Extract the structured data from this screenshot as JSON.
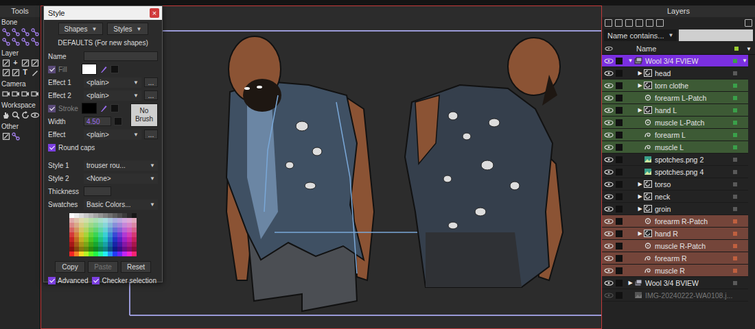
{
  "tools_panel": {
    "title": "Tools",
    "sections": [
      {
        "label": "Bone",
        "tools": [
          {
            "kind": "bone"
          },
          {
            "kind": "bone"
          },
          {
            "kind": "bone"
          },
          {
            "kind": "bone"
          },
          {
            "kind": "bone"
          },
          {
            "kind": "bone"
          },
          {
            "kind": "bone"
          },
          {
            "kind": "bone"
          }
        ]
      },
      {
        "label": "Layer",
        "tools": [
          {
            "kind": "transform"
          },
          {
            "kind": "add",
            "glyph": "+"
          },
          {
            "kind": "transform"
          },
          {
            "kind": "transform"
          },
          {
            "kind": "transform"
          },
          {
            "kind": "transform"
          },
          {
            "kind": "text",
            "glyph": "T"
          },
          {
            "kind": "pen"
          }
        ]
      },
      {
        "label": "Camera",
        "tools": [
          {
            "kind": "camera"
          },
          {
            "kind": "camera"
          },
          {
            "kind": "camera"
          },
          {
            "kind": "camera"
          }
        ]
      },
      {
        "label": "Workspace",
        "tools": [
          {
            "kind": "hand"
          },
          {
            "kind": "zoom"
          },
          {
            "kind": "rotate"
          },
          {
            "kind": "eye"
          }
        ]
      },
      {
        "label": "Other",
        "tools": [
          {
            "kind": "other"
          },
          {
            "kind": "bone"
          }
        ]
      }
    ]
  },
  "style_window": {
    "title": "Style",
    "close": "×",
    "menus": [
      {
        "label": "Shapes",
        "arrow": "▼"
      },
      {
        "label": "Styles",
        "arrow": "▼"
      }
    ],
    "heading": "DEFAULTS (For new shapes)",
    "name": {
      "label": "Name",
      "value": ""
    },
    "fill": {
      "label": "Fill",
      "checked": true,
      "disabled": true,
      "color": "#ffffff"
    },
    "effects": [
      {
        "label": "Effect 1",
        "value": "<plain>",
        "arrow": "▼",
        "more": "..."
      },
      {
        "label": "Effect 2",
        "value": "<plain>",
        "arrow": "▼",
        "more": "..."
      }
    ],
    "stroke": {
      "label": "Stroke",
      "checked": true,
      "disabled": true,
      "color": "#000000",
      "brush_button": "No Brush"
    },
    "width": {
      "label": "Width",
      "value": "4.50"
    },
    "stroke_effect": {
      "label": "Effect",
      "value": "<plain>",
      "arrow": "▼",
      "more": "..."
    },
    "round_caps": {
      "label": "Round caps",
      "checked": true
    },
    "styles": [
      {
        "label": "Style 1",
        "value": "trouser rou...",
        "arrow": "▼"
      },
      {
        "label": "Style 2",
        "value": "<None>",
        "arrow": "▼"
      }
    ],
    "thickness": {
      "label": "Thickness",
      "value": ""
    },
    "swatches": {
      "label": "Swatches",
      "value": "Basic Colors...",
      "arrow": "▼"
    },
    "buttons": [
      {
        "label": "Copy",
        "disabled": false
      },
      {
        "label": "Paste",
        "disabled": true
      },
      {
        "label": "Reset",
        "disabled": false
      }
    ],
    "options": [
      {
        "label": "Advanced",
        "checked": true
      },
      {
        "label": "Checker selection",
        "checked": true
      }
    ]
  },
  "layers_panel": {
    "title": "Layers",
    "filter": {
      "label": "Name contains...",
      "arrow": "▼",
      "value": ""
    },
    "column": "Name",
    "column_arrow": "▼",
    "rows": [
      {
        "name": "Wool 3/4 FVIEW",
        "kind": "group",
        "depth": 0,
        "arrow": "▼",
        "expanded": true,
        "selected": true,
        "visible": true,
        "color": "#7a2fe0",
        "label": "#3aa04a",
        "menu": "▼"
      },
      {
        "name": "head",
        "kind": "switch",
        "depth": 1,
        "arrow": "▶",
        "expanded": false,
        "selected": false,
        "visible": true,
        "color": null,
        "label": "#5a5a5a"
      },
      {
        "name": "torn clothe",
        "kind": "switch",
        "depth": 1,
        "arrow": "▶",
        "expanded": false,
        "selected": false,
        "visible": true,
        "color": "#3d5a35",
        "label": "#3aa04a"
      },
      {
        "name": "forearm L-Patch",
        "kind": "patch",
        "depth": 1,
        "selected": false,
        "visible": true,
        "color": "#3d5a35",
        "label": "#3aa04a"
      },
      {
        "name": "hand L",
        "kind": "switch",
        "depth": 1,
        "arrow": "▶",
        "expanded": false,
        "selected": false,
        "visible": true,
        "color": "#3d5a35",
        "label": "#3aa04a"
      },
      {
        "name": "muscle L-Patch",
        "kind": "patch",
        "depth": 1,
        "selected": false,
        "visible": true,
        "color": "#3d5a35",
        "label": "#3aa04a"
      },
      {
        "name": "forearm L",
        "kind": "vector",
        "depth": 1,
        "selected": false,
        "visible": true,
        "color": "#3d5a35",
        "label": "#3aa04a"
      },
      {
        "name": "muscle L",
        "kind": "vector",
        "depth": 1,
        "selected": false,
        "visible": true,
        "color": "#3d5a35",
        "label": "#3aa04a"
      },
      {
        "name": "spotches.png 2",
        "kind": "image",
        "depth": 1,
        "selected": false,
        "visible": true,
        "color": null,
        "label": "#5a5a5a"
      },
      {
        "name": "spotches.png 4",
        "kind": "image",
        "depth": 1,
        "selected": false,
        "visible": true,
        "color": null,
        "label": "#5a5a5a"
      },
      {
        "name": "torso",
        "kind": "switch",
        "depth": 1,
        "arrow": "▶",
        "expanded": false,
        "selected": false,
        "visible": true,
        "color": null,
        "label": "#5a5a5a"
      },
      {
        "name": "neck",
        "kind": "switch",
        "depth": 1,
        "arrow": "▶",
        "expanded": false,
        "selected": false,
        "visible": true,
        "color": null,
        "label": "#5a5a5a"
      },
      {
        "name": "groin",
        "kind": "switch",
        "depth": 1,
        "arrow": "▶",
        "expanded": false,
        "selected": false,
        "visible": true,
        "color": null,
        "label": "#5a5a5a"
      },
      {
        "name": "forearm R-Patch",
        "kind": "patch",
        "depth": 1,
        "selected": false,
        "visible": true,
        "color": "#74453a",
        "label": "#c0603f"
      },
      {
        "name": "hand R",
        "kind": "switch",
        "depth": 1,
        "arrow": "▶",
        "expanded": false,
        "selected": false,
        "visible": true,
        "color": "#74453a",
        "label": "#c0603f"
      },
      {
        "name": "muscle R-Patch",
        "kind": "patch",
        "depth": 1,
        "selected": false,
        "visible": true,
        "color": "#74453a",
        "label": "#c0603f"
      },
      {
        "name": "forearm R",
        "kind": "vector",
        "depth": 1,
        "selected": false,
        "visible": true,
        "color": "#74453a",
        "label": "#c0603f"
      },
      {
        "name": "muscle R",
        "kind": "vector",
        "depth": 1,
        "selected": false,
        "visible": true,
        "color": "#74453a",
        "label": "#c0603f"
      },
      {
        "name": "Wool 3/4 BVIEW",
        "kind": "group",
        "depth": 0,
        "arrow": "▶",
        "expanded": false,
        "selected": false,
        "visible": true,
        "color": null,
        "label": "#5a5a5a"
      },
      {
        "name": "IMG-20240222-WA0108.j...",
        "kind": "image",
        "depth": 0,
        "selected": false,
        "visible": false,
        "color": null,
        "label": null
      }
    ]
  }
}
